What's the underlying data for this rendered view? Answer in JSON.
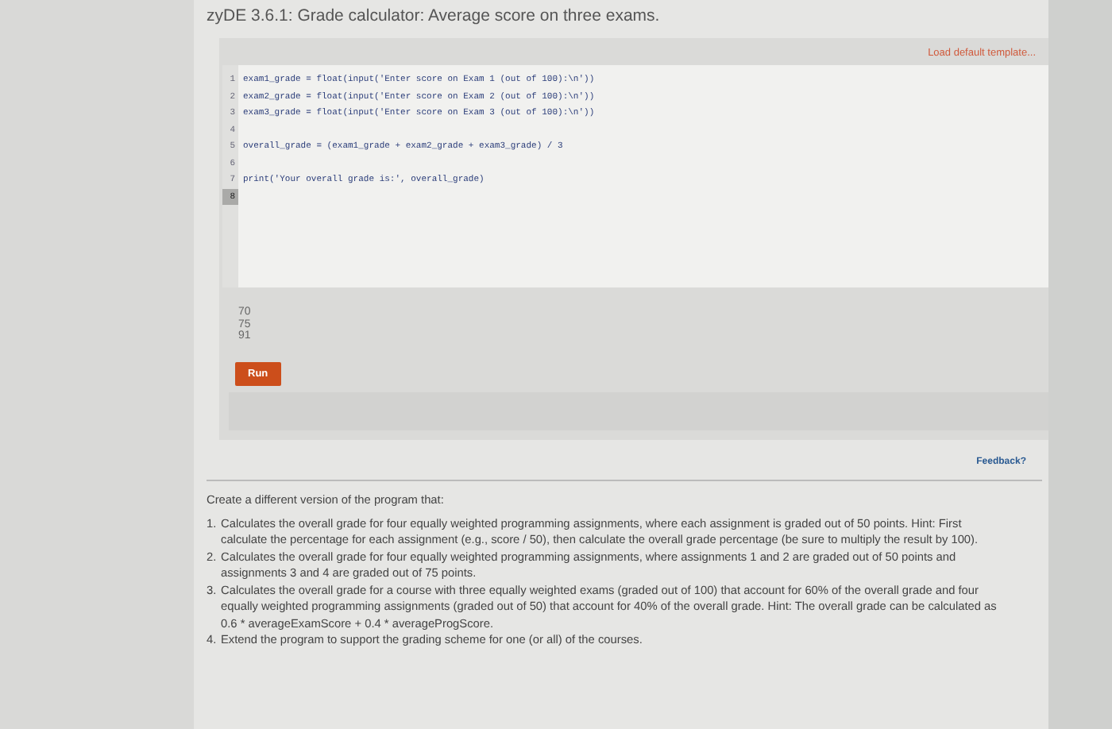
{
  "title": "zyDE 3.6.1: Grade calculator: Average score on three exams.",
  "load_template": "Load default template...",
  "code_lines": [
    {
      "number": "1",
      "text": "exam1_grade = float(input('Enter score on Exam 1 (out of 100):\\n'))",
      "active": false
    },
    {
      "number": "2",
      "text": "exam2_grade = float(input('Enter score on Exam 2 (out of 100):\\n'))",
      "active": false
    },
    {
      "number": "3",
      "text": "exam3_grade = float(input('Enter score on Exam 3 (out of 100):\\n'))",
      "active": false
    },
    {
      "number": "4",
      "active": false
    },
    {
      "number": "5",
      "text": "overall_grade = (exam1_grade + exam2_grade + exam3_grade) / 3",
      "active": false
    },
    {
      "number": "6",
      "active": false
    },
    {
      "number": "7",
      "text": "print('Your overall grade is:', overall_grade)",
      "active": false
    },
    {
      "number": "8",
      "active": true
    }
  ],
  "input_lines": [
    "70",
    "75",
    "91"
  ],
  "run_button": "Run",
  "feedback": "Feedback?",
  "intro": "Create a different version of the program that:",
  "items": [
    {
      "number": "1.",
      "text": "Calculates the overall grade for four equally weighted programming assignments, where each assignment is graded out of 50 points. Hint: First calculate the percentage for each assignment (e.g., score / 50), then calculate the overall grade percentage (be sure to multiply the result by 100)."
    },
    {
      "number": "2.",
      "text": "Calculates the overall grade for four equally weighted programming assignments, where assignments 1 and 2 are graded out of 50 points and assignments 3 and 4 are graded out of 75 points."
    },
    {
      "number": "3.",
      "text": "Calculates the overall grade for a course with three equally weighted exams (graded out of 100) that account for 60% of the overall grade and four equally weighted programming assignments (graded out of 50) that account for 40% of the overall grade. Hint: The overall grade can be calculated as 0.6 * averageExamScore + 0.4 * averageProgScore."
    },
    {
      "number": "4.",
      "text": "Extend the program to support the grading scheme for one (or all) of the courses."
    }
  ]
}
